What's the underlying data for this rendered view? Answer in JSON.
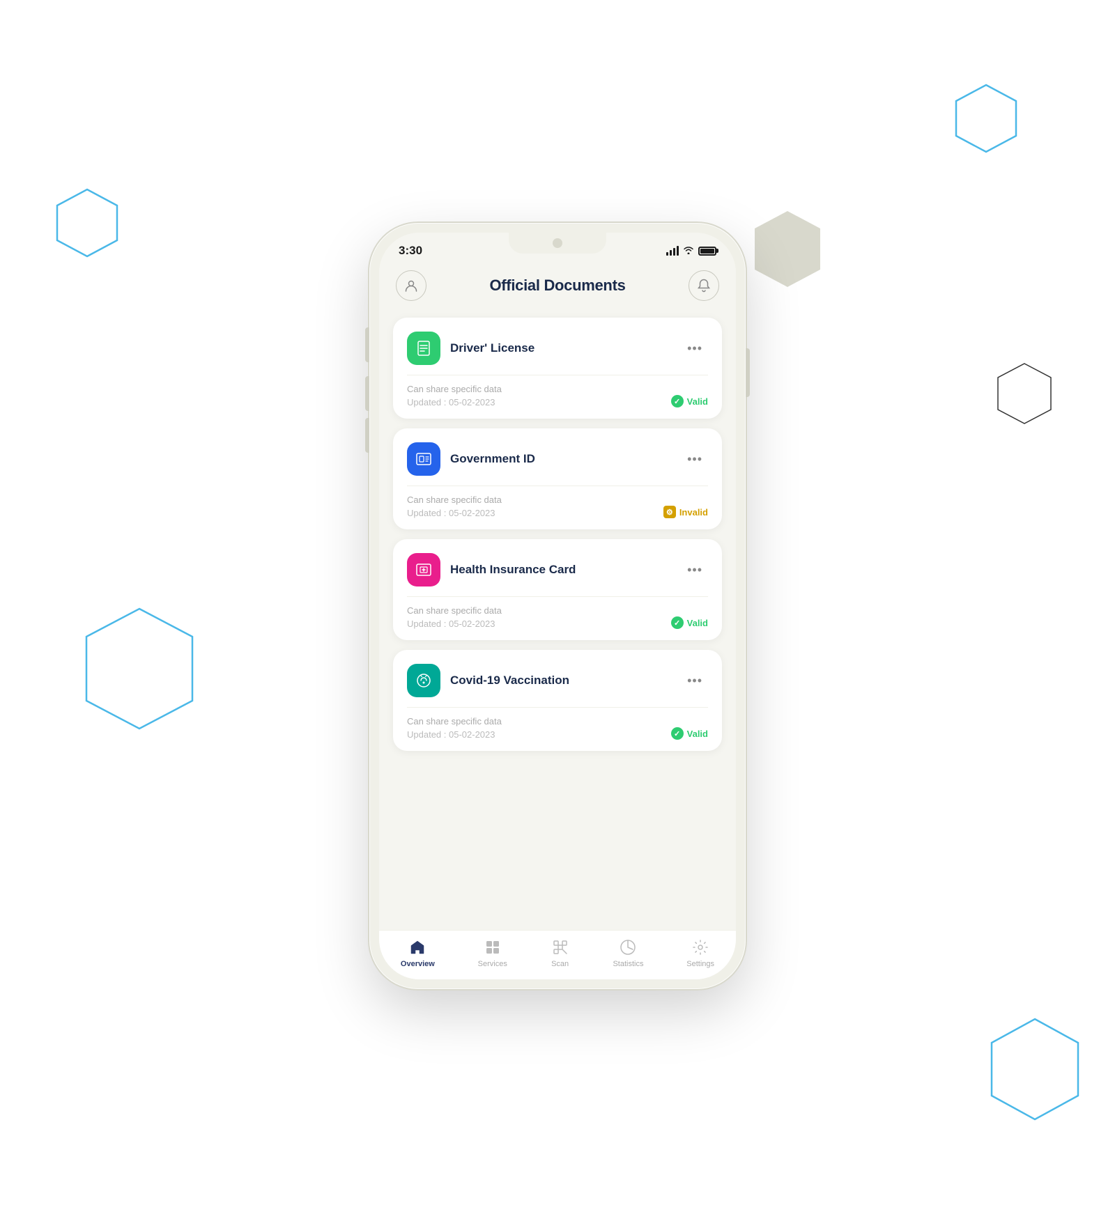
{
  "status_bar": {
    "time": "3:30"
  },
  "header": {
    "title": "Official Documents",
    "profile_btn_label": "Profile",
    "notification_btn_label": "Notifications"
  },
  "documents": [
    {
      "id": "driver-license",
      "title": "Driver' License",
      "icon_color": "green",
      "share_text": "Can share specific data",
      "updated": "Updated : 05-02-2023",
      "status": "Valid",
      "status_type": "valid"
    },
    {
      "id": "government-id",
      "title": "Government ID",
      "icon_color": "blue",
      "share_text": "Can share specific data",
      "updated": "Updated : 05-02-2023",
      "status": "Invalid",
      "status_type": "invalid"
    },
    {
      "id": "health-insurance",
      "title": "Health Insurance Card",
      "icon_color": "pink",
      "share_text": "Can share specific data",
      "updated": "Updated : 05-02-2023",
      "status": "Valid",
      "status_type": "valid"
    },
    {
      "id": "covid-vaccination",
      "title": "Covid-19 Vaccination",
      "icon_color": "teal",
      "share_text": "Can share specific data",
      "updated": "Updated : 05-02-2023",
      "status": "Valid",
      "status_type": "valid"
    }
  ],
  "bottom_nav": {
    "items": [
      {
        "id": "overview",
        "label": "Overview",
        "active": true
      },
      {
        "id": "services",
        "label": "Services",
        "active": false
      },
      {
        "id": "scan",
        "label": "Scan",
        "active": false
      },
      {
        "id": "statistics",
        "label": "Statistics",
        "active": false
      },
      {
        "id": "settings",
        "label": "Settings",
        "active": false
      }
    ]
  },
  "doc_menu_dots": "•••"
}
